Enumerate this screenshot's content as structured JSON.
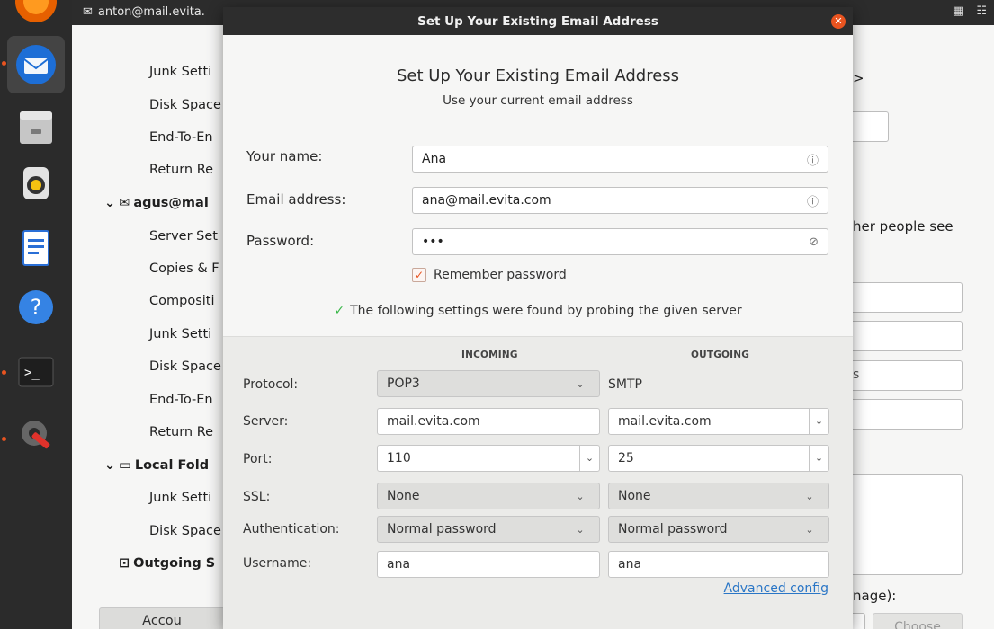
{
  "topbar": {
    "account": "anton@mail.evita."
  },
  "tree": {
    "item1": "Junk Setti",
    "item2": "Disk Space",
    "item3": "End-To-En",
    "item4": "Return Re",
    "account2": "agus@mai",
    "item5": "Server Set",
    "item6": "Copies & F",
    "item7": "Compositi",
    "item8": "Junk Setti",
    "item9": "Disk Space",
    "item10": "End-To-En",
    "item11": "Return Re",
    "local": "Local Fold",
    "item12": "Junk Setti",
    "item13": "Disk Space",
    "outgoing": "Outgoing S",
    "account_button": "Accou"
  },
  "bg_right": {
    "arrow": ">",
    "other_people": "her people see",
    "s_fragment": "s",
    "image_fragment": "nage):",
    "choose": "Choose"
  },
  "dialog": {
    "title": "Set Up Your Existing Email Address",
    "heading": "Set Up Your Existing Email Address",
    "subheading": "Use your current email address",
    "name_label": "Your name:",
    "name_value": "Ana",
    "email_label": "Email address:",
    "email_value": "ana@mail.evita.com",
    "password_label": "Password:",
    "password_value": "•••",
    "remember_label": "Remember password",
    "found_text": "The following settings were found by probing the given server",
    "incoming": "INCOMING",
    "outgoing": "OUTGOING",
    "protocol_label": "Protocol:",
    "protocol_value": "POP3",
    "smtp": "SMTP",
    "server_label": "Server:",
    "server_in": "mail.evita.com",
    "server_out": "mail.evita.com",
    "port_label": "Port:",
    "port_in": "110",
    "port_out": "25",
    "ssl_label": "SSL:",
    "ssl_in": "None",
    "ssl_out": "None",
    "auth_label": "Authentication:",
    "auth_in": "Normal password",
    "auth_out": "Normal password",
    "username_label": "Username:",
    "username_in": "ana",
    "username_out": "ana",
    "advanced": "Advanced config"
  },
  "colors": {
    "accent": "#e95420",
    "link": "#2a76c6",
    "check": "#3bb84a"
  }
}
